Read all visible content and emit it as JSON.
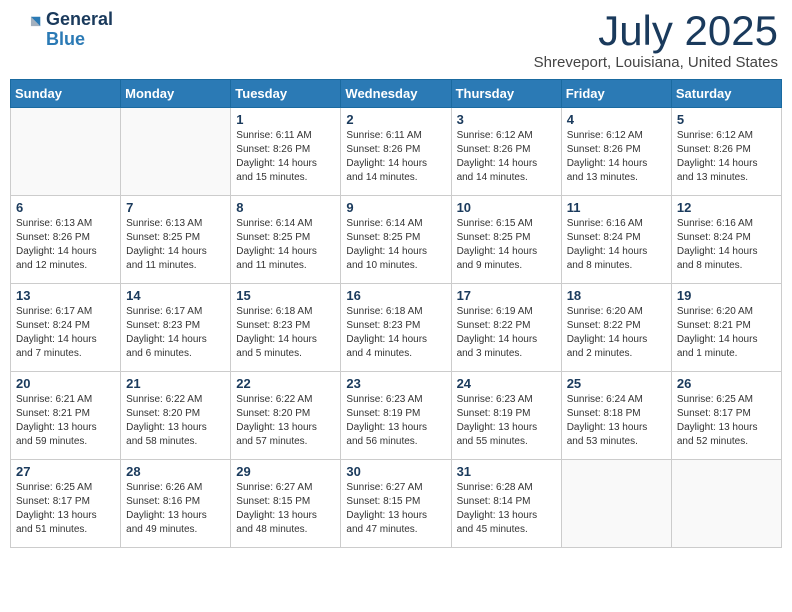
{
  "header": {
    "logo_general": "General",
    "logo_blue": "Blue",
    "month_title": "July 2025",
    "location": "Shreveport, Louisiana, United States"
  },
  "days_of_week": [
    "Sunday",
    "Monday",
    "Tuesday",
    "Wednesday",
    "Thursday",
    "Friday",
    "Saturday"
  ],
  "weeks": [
    [
      {
        "day": "",
        "info": ""
      },
      {
        "day": "",
        "info": ""
      },
      {
        "day": "1",
        "info": "Sunrise: 6:11 AM\nSunset: 8:26 PM\nDaylight: 14 hours and 15 minutes."
      },
      {
        "day": "2",
        "info": "Sunrise: 6:11 AM\nSunset: 8:26 PM\nDaylight: 14 hours and 14 minutes."
      },
      {
        "day": "3",
        "info": "Sunrise: 6:12 AM\nSunset: 8:26 PM\nDaylight: 14 hours and 14 minutes."
      },
      {
        "day": "4",
        "info": "Sunrise: 6:12 AM\nSunset: 8:26 PM\nDaylight: 14 hours and 13 minutes."
      },
      {
        "day": "5",
        "info": "Sunrise: 6:12 AM\nSunset: 8:26 PM\nDaylight: 14 hours and 13 minutes."
      }
    ],
    [
      {
        "day": "6",
        "info": "Sunrise: 6:13 AM\nSunset: 8:26 PM\nDaylight: 14 hours and 12 minutes."
      },
      {
        "day": "7",
        "info": "Sunrise: 6:13 AM\nSunset: 8:25 PM\nDaylight: 14 hours and 11 minutes."
      },
      {
        "day": "8",
        "info": "Sunrise: 6:14 AM\nSunset: 8:25 PM\nDaylight: 14 hours and 11 minutes."
      },
      {
        "day": "9",
        "info": "Sunrise: 6:14 AM\nSunset: 8:25 PM\nDaylight: 14 hours and 10 minutes."
      },
      {
        "day": "10",
        "info": "Sunrise: 6:15 AM\nSunset: 8:25 PM\nDaylight: 14 hours and 9 minutes."
      },
      {
        "day": "11",
        "info": "Sunrise: 6:16 AM\nSunset: 8:24 PM\nDaylight: 14 hours and 8 minutes."
      },
      {
        "day": "12",
        "info": "Sunrise: 6:16 AM\nSunset: 8:24 PM\nDaylight: 14 hours and 8 minutes."
      }
    ],
    [
      {
        "day": "13",
        "info": "Sunrise: 6:17 AM\nSunset: 8:24 PM\nDaylight: 14 hours and 7 minutes."
      },
      {
        "day": "14",
        "info": "Sunrise: 6:17 AM\nSunset: 8:23 PM\nDaylight: 14 hours and 6 minutes."
      },
      {
        "day": "15",
        "info": "Sunrise: 6:18 AM\nSunset: 8:23 PM\nDaylight: 14 hours and 5 minutes."
      },
      {
        "day": "16",
        "info": "Sunrise: 6:18 AM\nSunset: 8:23 PM\nDaylight: 14 hours and 4 minutes."
      },
      {
        "day": "17",
        "info": "Sunrise: 6:19 AM\nSunset: 8:22 PM\nDaylight: 14 hours and 3 minutes."
      },
      {
        "day": "18",
        "info": "Sunrise: 6:20 AM\nSunset: 8:22 PM\nDaylight: 14 hours and 2 minutes."
      },
      {
        "day": "19",
        "info": "Sunrise: 6:20 AM\nSunset: 8:21 PM\nDaylight: 14 hours and 1 minute."
      }
    ],
    [
      {
        "day": "20",
        "info": "Sunrise: 6:21 AM\nSunset: 8:21 PM\nDaylight: 13 hours and 59 minutes."
      },
      {
        "day": "21",
        "info": "Sunrise: 6:22 AM\nSunset: 8:20 PM\nDaylight: 13 hours and 58 minutes."
      },
      {
        "day": "22",
        "info": "Sunrise: 6:22 AM\nSunset: 8:20 PM\nDaylight: 13 hours and 57 minutes."
      },
      {
        "day": "23",
        "info": "Sunrise: 6:23 AM\nSunset: 8:19 PM\nDaylight: 13 hours and 56 minutes."
      },
      {
        "day": "24",
        "info": "Sunrise: 6:23 AM\nSunset: 8:19 PM\nDaylight: 13 hours and 55 minutes."
      },
      {
        "day": "25",
        "info": "Sunrise: 6:24 AM\nSunset: 8:18 PM\nDaylight: 13 hours and 53 minutes."
      },
      {
        "day": "26",
        "info": "Sunrise: 6:25 AM\nSunset: 8:17 PM\nDaylight: 13 hours and 52 minutes."
      }
    ],
    [
      {
        "day": "27",
        "info": "Sunrise: 6:25 AM\nSunset: 8:17 PM\nDaylight: 13 hours and 51 minutes."
      },
      {
        "day": "28",
        "info": "Sunrise: 6:26 AM\nSunset: 8:16 PM\nDaylight: 13 hours and 49 minutes."
      },
      {
        "day": "29",
        "info": "Sunrise: 6:27 AM\nSunset: 8:15 PM\nDaylight: 13 hours and 48 minutes."
      },
      {
        "day": "30",
        "info": "Sunrise: 6:27 AM\nSunset: 8:15 PM\nDaylight: 13 hours and 47 minutes."
      },
      {
        "day": "31",
        "info": "Sunrise: 6:28 AM\nSunset: 8:14 PM\nDaylight: 13 hours and 45 minutes."
      },
      {
        "day": "",
        "info": ""
      },
      {
        "day": "",
        "info": ""
      }
    ]
  ]
}
